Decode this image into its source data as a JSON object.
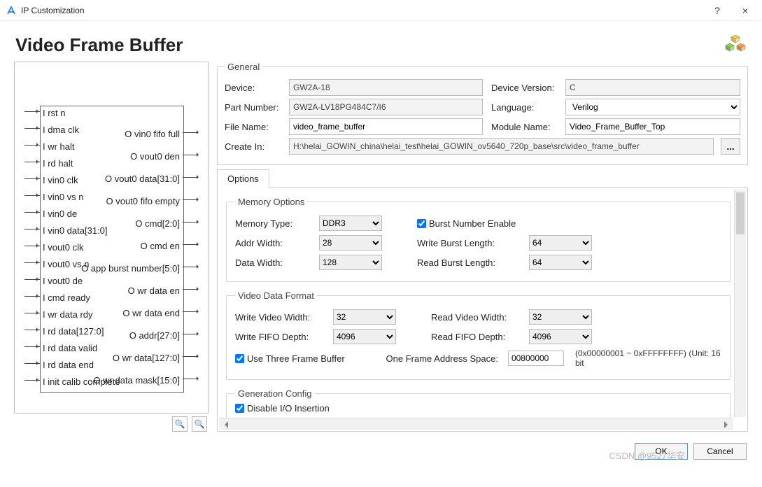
{
  "window": {
    "title": "IP Customization",
    "help": "?",
    "close": "×"
  },
  "header": {
    "title": "Video Frame Buffer"
  },
  "general": {
    "legend": "General",
    "device_lbl": "Device:",
    "device": "GW2A-18",
    "devver_lbl": "Device Version:",
    "devver": "C",
    "part_lbl": "Part Number:",
    "part": "GW2A-LV18PG484C7/I6",
    "lang_lbl": "Language:",
    "lang": "Verilog",
    "file_lbl": "File Name:",
    "file": "video_frame_buffer",
    "mod_lbl": "Module Name:",
    "mod": "Video_Frame_Buffer_Top",
    "create_lbl": "Create In:",
    "create": "H:\\helai_GOWIN_china\\helai_test\\helai_GOWIN_ov5640_720p_base\\src\\video_frame_buffer",
    "browse": "..."
  },
  "tabs": {
    "options": "Options"
  },
  "memory": {
    "legend": "Memory Options",
    "type_lbl": "Memory Type:",
    "type": "DDR3",
    "burst_en": "Burst Number Enable",
    "addrw_lbl": "Addr Width:",
    "addrw": "28",
    "wbl_lbl": "Write Burst Length:",
    "wbl": "64",
    "dataw_lbl": "Data Width:",
    "dataw": "128",
    "rbl_lbl": "Read Burst Length:",
    "rbl": "64"
  },
  "video": {
    "legend": "Video Data Format",
    "wvw_lbl": "Write Video Width:",
    "wvw": "32",
    "rvw_lbl": "Read Video Width:",
    "rvw": "32",
    "wfd_lbl": "Write FIFO Depth:",
    "wfd": "4096",
    "rfd_lbl": "Read FIFO Depth:",
    "rfd": "4096",
    "three": "Use Three Frame Buffer",
    "ofa_lbl": "One Frame Address Space:",
    "ofa": "00800000",
    "hint": "(0x00000001 ~ 0xFFFFFFFF) (Unit: 16 bit"
  },
  "gen": {
    "legend": "Generation Config",
    "disable_io": "Disable I/O Insertion"
  },
  "diagram": {
    "left": [
      "I rst n",
      "I dma clk",
      "I wr halt",
      "I rd halt",
      "I vin0 clk",
      "I vin0 vs n",
      "I vin0 de",
      "I vin0 data[31:0]",
      "I vout0 clk",
      "I vout0 vs n",
      "I vout0 de",
      "I cmd ready",
      "I wr data rdy",
      "I rd data[127:0]",
      "I rd data valid",
      "I rd data end",
      "I init calib complete"
    ],
    "right": [
      "O vin0 fifo full",
      "O vout0 den",
      "O vout0 data[31:0]",
      "O vout0 fifo empty",
      "O cmd[2:0]",
      "O cmd en",
      "O app burst number[5:0]",
      "O wr data en",
      "O wr data end",
      "O addr[27:0]",
      "O wr data[127:0]",
      "O wr data mask[15:0]"
    ]
  },
  "footer": {
    "ok": "OK",
    "cancel": "Cancel"
  },
  "watermark": "CSDN @9527华安"
}
